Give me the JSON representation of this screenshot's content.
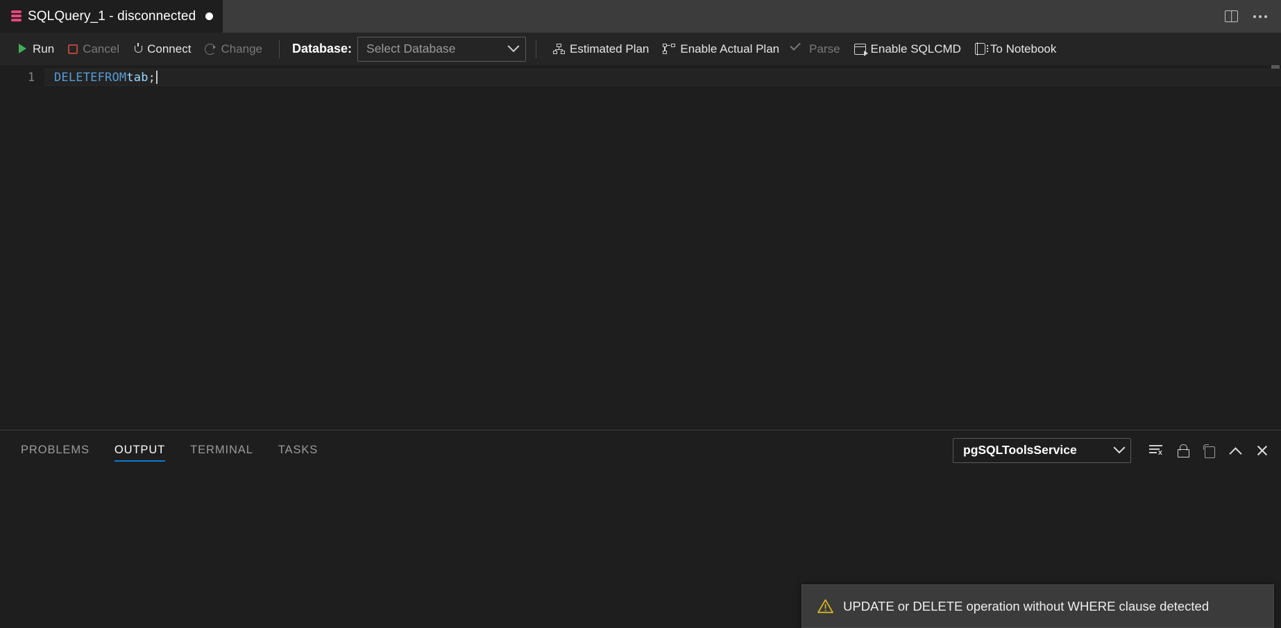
{
  "tab": {
    "icon": "database-icon",
    "title": "SQLQuery_1 - disconnected",
    "dirty_indicator": "●"
  },
  "tabbar_actions": {
    "split_editor": "split-editor-icon",
    "more_actions": "more-actions-icon"
  },
  "toolbar": {
    "run_label": "Run",
    "cancel_label": "Cancel",
    "connect_label": "Connect",
    "change_label": "Change",
    "database_label": "Database:",
    "database_value": "Select Database",
    "database_placeholder": "Select Database",
    "estimated_plan_label": "Estimated Plan",
    "enable_actual_plan_label": "Enable Actual Plan",
    "parse_label": "Parse",
    "enable_sqlcmd_label": "Enable SQLCMD",
    "to_notebook_label": "To Notebook"
  },
  "editor": {
    "line_number": "1",
    "code": {
      "keyword1": "DELETE",
      "space1": " ",
      "keyword2": "FROM",
      "space2": " ",
      "identifier": "tab",
      "terminator": ";"
    },
    "full_text": "DELETE FROM tab;"
  },
  "panel": {
    "tabs": [
      {
        "label": "PROBLEMS",
        "active": false
      },
      {
        "label": "OUTPUT",
        "active": true
      },
      {
        "label": "TERMINAL",
        "active": false
      },
      {
        "label": "TASKS",
        "active": false
      }
    ],
    "channel": "pgSQLToolsService",
    "actions": {
      "clear_output": "clear-output-icon",
      "lock_scroll": "lock-icon",
      "open_in_editor": "open-in-editor-icon",
      "maximize": "chevron-up-icon",
      "close": "close-icon"
    },
    "body_text": ""
  },
  "notification": {
    "icon": "warning-icon",
    "message": "UPDATE or DELETE operation without WHERE clause detected"
  },
  "colors": {
    "accent": "#0c7bd1",
    "tab_icon": "#e8467c",
    "run_green": "#3fae5a",
    "cancel_red": "#b4453a",
    "keyword_blue": "#569cd6",
    "identifier_blue": "#9cdcfe",
    "warning_yellow": "#e0c020",
    "editor_bg": "#1e1e1e",
    "toolbar_bg": "#252526"
  }
}
